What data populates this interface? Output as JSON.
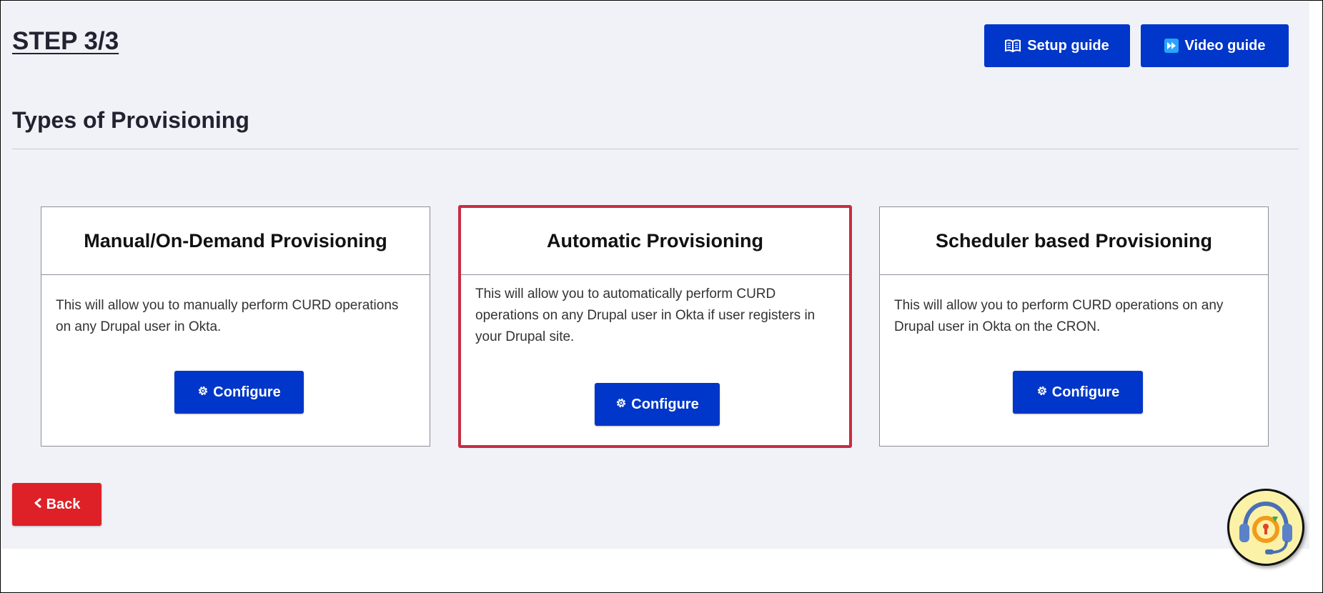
{
  "header": {
    "step": "STEP 3/3",
    "setup_guide_label": "Setup guide",
    "video_guide_label": "Video guide",
    "setup_icon": "book-open-icon",
    "video_icon": "fast-forward-icon"
  },
  "section": {
    "title": "Types of Provisioning"
  },
  "cards": [
    {
      "title": "Manual/On-Demand Provisioning",
      "description": "This will allow you to manually perform CURD operations on any Drupal user in Okta.",
      "button_label": "Configure",
      "highlighted": false
    },
    {
      "title": "Automatic Provisioning",
      "description": "This will allow you to automatically perform CURD operations on any Drupal user in Okta if user registers in your Drupal site.",
      "button_label": "Configure",
      "highlighted": true
    },
    {
      "title": "Scheduler based Provisioning",
      "description": "This will allow you to perform CURD operations on any Drupal user in Okta on the CRON.",
      "button_label": "Configure",
      "highlighted": false
    }
  ],
  "footer": {
    "back_label": "Back",
    "back_icon": "chevron-left-icon",
    "support_icon": "support-headset-icon"
  },
  "colors": {
    "primary_button": "#0036c9",
    "back_button": "#de2027",
    "highlight_border": "#c62d42",
    "panel_background": "#f1f2f7",
    "support_badge": "#fbf2a8"
  }
}
